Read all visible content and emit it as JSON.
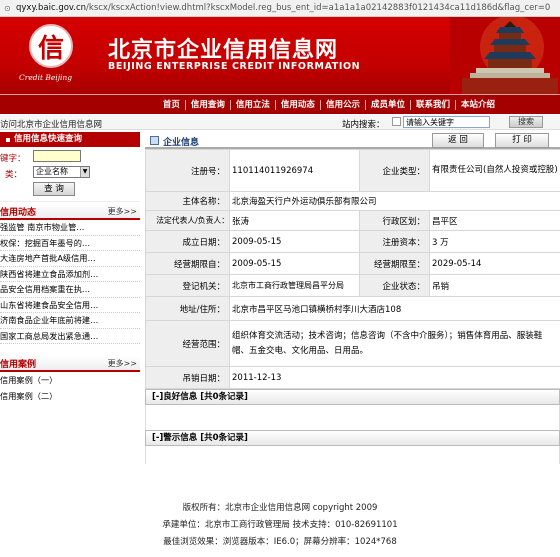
{
  "browser": {
    "url_host": "qyxy.baic.gov.cn",
    "url_path": "/kscx/kscxAction!view.dhtml?kscxModel.reg_bus_ent_id=a1a1a1a02142883f0121434ca11d186d&flag_cer=0"
  },
  "banner": {
    "seal_char": "信",
    "script": "Credit Beijing",
    "title_cn": "北京市企业信用信息网",
    "title_en": "BEIJING ENTERPRISE CREDIT INFORMATION"
  },
  "nav": [
    "首页",
    "信用查询",
    "信用立法",
    "信用动态",
    "信用公示",
    "成员单位",
    "联系我们",
    "本站介绍"
  ],
  "location": "访问北京市企业信用信息网",
  "site_search": {
    "label": "站内搜索：",
    "placeholder": "请输入关键字",
    "button": "搜索"
  },
  "quick_search": {
    "title": "信用信息快速查询",
    "label1": "键字：",
    "label2": "类：",
    "select_value": "企业名称",
    "button": "查 询"
  },
  "news": {
    "title": "信用动态",
    "more": "更多>>",
    "items": [
      "强监管 南京市物业管…",
      "权保：挖掘百年墨号的…",
      "大连房地产首批A级信用…",
      "陕西省将建立食品添加剂…",
      "品安全信用档案重在执…",
      "山东省将建食品安全信用…",
      "济南食品企业年底前将建…",
      "国家工商总局发出紧急通…"
    ]
  },
  "cases": {
    "title": "信用案例",
    "more": "更多>>",
    "items": [
      "信用案例（一）",
      "信用案例（二）"
    ]
  },
  "main": {
    "title": "企业信息",
    "back": "返 回",
    "print": "打 印",
    "fields": {
      "reg_no_label": "注册号：",
      "reg_no": "110114011926974",
      "type_label": "企业类型：",
      "type": "有限责任公司(自然人投资或控股)",
      "name_label": "主体名称：",
      "name": "北京海盈天行户外运动俱乐部有限公司",
      "rep_label": "法定代表人/负责人：",
      "rep": "张涛",
      "district_label": "行政区划：",
      "district": "昌平区",
      "est_label": "成立日期：",
      "est": "2009-05-15",
      "capital_label": "注册资本：",
      "capital": "3 万",
      "from_label": "经营期限自：",
      "from": "2009-05-15",
      "to_label": "经营期限至：",
      "to": "2029-05-14",
      "authority_label": "登记机关：",
      "authority": "北京市工商行政管理局昌平分局",
      "status_label": "企业状态：",
      "status": "吊销",
      "address_label": "地址/住所：",
      "address": "北京市昌平区马池口镇横桥村李川大酒店108",
      "scope_label": "经营范围：",
      "scope": "组织体育交流活动；技术咨询；信息咨询（不含中介服务）；销售体育用品、服装鞋帽、五金交电、文化用品、日用品。",
      "revoke_label": "吊销日期：",
      "revoke": "2011-12-13"
    },
    "good_info": "[-]良好信息 [共0条记录]",
    "warn_info": "[-]警示信息 [共0条记录]"
  },
  "footer": {
    "line1": "版权所有：北京市企业信用信息网 copyright 2009",
    "line2": "承建单位：北京市工商行政管理局 技术支持：010-82691101",
    "line3": "最佳浏览效果：浏览器版本：IE6.0；屏幕分辨率：1024*768"
  }
}
